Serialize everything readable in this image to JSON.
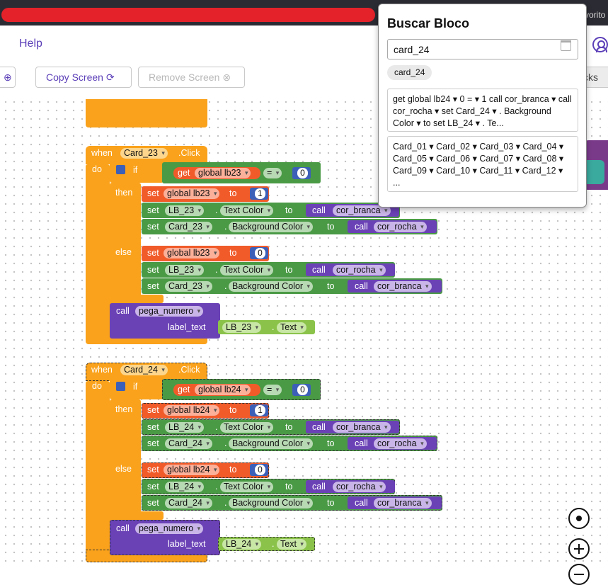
{
  "top": {
    "right_text": "vorito"
  },
  "header": {
    "help_label": "Help"
  },
  "toolbar": {
    "partial_icon": "⊕",
    "copy_label": "Copy Screen",
    "copy_icon": "⟳",
    "remove_label": "Remove Screen",
    "remove_icon": "⊗",
    "right_partial": "cks"
  },
  "search": {
    "title": "Buscar Bloco",
    "value": "card_24",
    "chip": "card_24",
    "result1": "get global lb24 ▾ 0 = ▾ 1 call cor_branca ▾ call cor_rocha ▾ set Card_24 ▾ . Background Color ▾ to set LB_24 ▾ . Te...",
    "result2": "Card_01 ▾ Card_02 ▾ Card_03 ▾ Card_04 ▾ Card_05 ▾ Card_06 ▾ Card_07 ▾ Card_08 ▾ Card_09 ▾ Card_10 ▾ Card_11 ▾ Card_12 ▾ ..."
  },
  "block23": {
    "when": "when",
    "comp": "Card_23",
    "event": ".Click",
    "do": "do",
    "if": "if",
    "get": "get",
    "var": "global lb23",
    "op": "=",
    "zero": "0",
    "then": "then",
    "else": "else",
    "set": "set",
    "to": "to",
    "one": "1",
    "label": "LB_23",
    "text_color": "Text Color",
    "bg_color": "Background Color",
    "call": "call",
    "branca": "cor_branca",
    "rocha": "cor_rocha",
    "dot": ".",
    "proc": "pega_numero",
    "arg": "label_text",
    "text": "Text"
  },
  "block24": {
    "when": "when",
    "comp": "Card_24",
    "event": ".Click",
    "do": "do",
    "if": "if",
    "get": "get",
    "var": "global lb24",
    "op": "=",
    "zero": "0",
    "then": "then",
    "else": "else",
    "set": "set",
    "to": "to",
    "one": "1",
    "label": "LB_24",
    "text_color": "Text Color",
    "bg_color": "Background Color",
    "call": "call",
    "branca": "cor_branca",
    "rocha": "cor_rocha",
    "dot": ".",
    "proc": "pega_numero",
    "arg": "label_text",
    "text": "Text"
  }
}
